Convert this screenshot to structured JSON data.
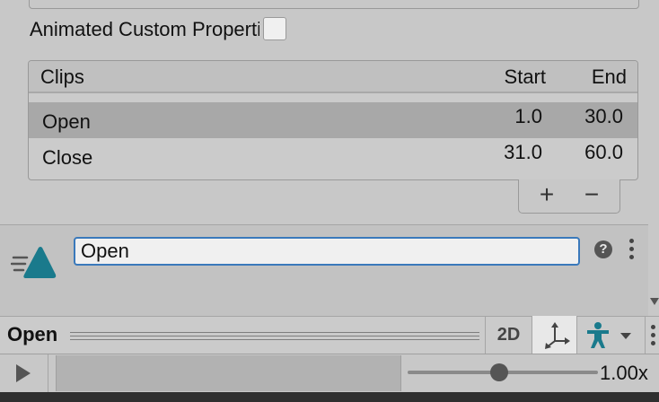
{
  "inspector": {
    "animated_custom_properties_label": "Animated Custom Properties",
    "animated_custom_properties_checked": false
  },
  "clips": {
    "columns": {
      "name": "Clips",
      "start": "Start",
      "end": "End"
    },
    "rows": [
      {
        "name": "Open",
        "start": "1.0",
        "end": "30.0",
        "selected": true
      },
      {
        "name": "Close",
        "start": "31.0",
        "end": "60.0",
        "selected": false
      }
    ],
    "add_label": "+",
    "remove_label": "−"
  },
  "clip_editor": {
    "name_value": "Open",
    "help_label": "?"
  },
  "preview": {
    "title": "Open",
    "mode_2d_label": "2D",
    "speed": "1.00x",
    "speed_fraction": 0.48
  },
  "colors": {
    "accent_teal": "#1a7a8c",
    "focus_blue": "#3a79bb",
    "selected_row": "#a8a8a8"
  },
  "icons": [
    "animation-clip-icon",
    "help-icon",
    "kebab-menu-icon",
    "pivot-gizmo-icon",
    "avatar-icon",
    "play-icon"
  ]
}
